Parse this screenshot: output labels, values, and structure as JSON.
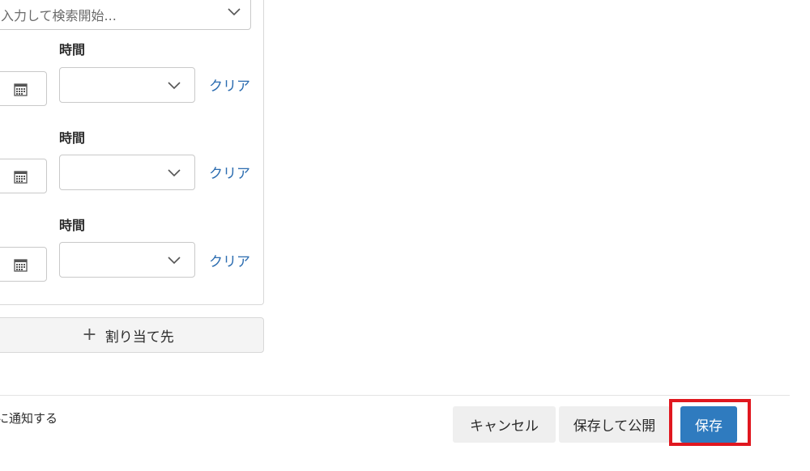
{
  "assignee_search": {
    "placeholder": "入力して検索開始..."
  },
  "rows": [
    {
      "time_label": "時間",
      "clear_label": "クリア"
    },
    {
      "time_label": "時間",
      "clear_label": "クリア"
    },
    {
      "time_label": "時間",
      "clear_label": "クリア"
    }
  ],
  "add_assignee_label": "割り当て先",
  "notify_text": "に通知する",
  "footer": {
    "cancel_label": "キャンセル",
    "save_publish_label": "保存して公開",
    "save_label": "保存"
  },
  "colors": {
    "accent": "#2f7bbf",
    "link": "#2b6cb0",
    "highlight": "#e0171f"
  },
  "icons": [
    "chevron-down-icon",
    "calendar-icon",
    "plus-icon"
  ]
}
